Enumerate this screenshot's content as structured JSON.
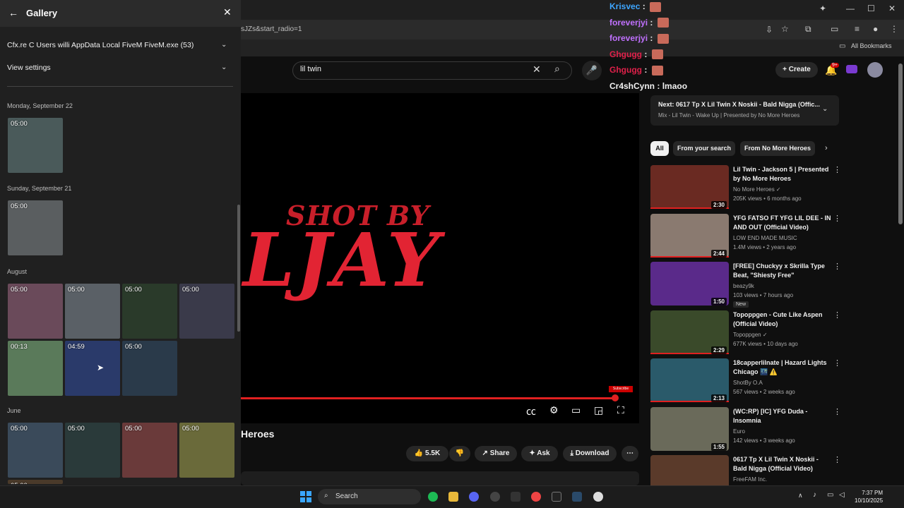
{
  "browser": {
    "url_fragment": "sJZs&start_radio=1",
    "bookmarks_label": "All Bookmarks"
  },
  "youtube": {
    "search_value": "lil twin",
    "create_label": "Create",
    "notification_count": "9+",
    "video_overlay_line1": "SHOT BY",
    "video_overlay_line2": "LJAY",
    "subscribe_watermark": "Subscribe",
    "progress_fraction": 0.94,
    "video_title_partial": "Heroes",
    "actions": {
      "likes": "5.5K",
      "share": "Share",
      "ask": "Ask",
      "download": "Download"
    },
    "next": {
      "title": "Next: 0617 Tp X Lil Twin X Noskii - Bald Nigga (Offic...",
      "subtitle": "Mix - Lil Twin - Wake Up | Presented by No More Heroes"
    },
    "chips": [
      "All",
      "From your search",
      "From No More Heroes"
    ],
    "recommendations": [
      {
        "title": "Lil Twin - Jackson 5 | Presented by No More Heroes",
        "channel": "No More Heroes",
        "verified": true,
        "meta": "205K views • 6 months ago",
        "duration": "2:30",
        "badge": "",
        "thumb_color": "#6a2a22",
        "watched_bar": true
      },
      {
        "title": "YFG FATSO FT YFG LIL DEE - IN AND OUT (Official Video)",
        "channel": "LOW END MADE MUSIC",
        "verified": false,
        "meta": "1.4M views • 2 years ago",
        "duration": "2:44",
        "badge": "",
        "thumb_color": "#8a7a70",
        "watched_bar": true
      },
      {
        "title": "[FREE] Chuckyy x Skrilla Type Beat, \"Shiesty Free\"",
        "channel": "beazy9k",
        "verified": false,
        "meta": "103 views • 7 hours ago",
        "duration": "1:50",
        "badge": "New",
        "thumb_color": "#5a2a8a",
        "watched_bar": false
      },
      {
        "title": "Topoppgen - Cute Like Aspen (Official Video)",
        "channel": "Topoppgen",
        "verified": true,
        "meta": "677K views • 10 days ago",
        "duration": "2:29",
        "badge": "",
        "thumb_color": "#3a4a2a",
        "watched_bar": true
      },
      {
        "title": "18capperlilnate | Hazard Lights Chicago 🌃 ⚠️",
        "channel": "ShotBy O.A",
        "verified": false,
        "meta": "567 views • 2 weeks ago",
        "duration": "2:13",
        "badge": "",
        "thumb_color": "#2a5a6a",
        "watched_bar": true
      },
      {
        "title": "(WC:RP) [IC] YFG Duda - Insomnia",
        "channel": "Euro",
        "verified": false,
        "meta": "142 views • 3 weeks ago",
        "duration": "1:55",
        "badge": "",
        "thumb_color": "#6a6a5a",
        "watched_bar": false
      },
      {
        "title": "0617 Tp X Lil Twin X Noskii - Bald Nigga (Official Video)",
        "channel": "FreeFAM Inc.",
        "verified": false,
        "meta": "",
        "duration": "",
        "badge": "",
        "thumb_color": "#5a3a2a",
        "watched_bar": false
      }
    ],
    "chat": [
      {
        "user": "Krisvec",
        "message": "",
        "color": "#3ea6ff",
        "emote": true
      },
      {
        "user": "foreverjyi",
        "message": "",
        "color": "#c070ff",
        "emote": true
      },
      {
        "user": "foreverjyi",
        "message": "",
        "color": "#c070ff",
        "emote": true
      },
      {
        "user": "Ghgugg",
        "message": "",
        "color": "#e0204a",
        "emote": true
      },
      {
        "user": "Ghgugg",
        "message": "",
        "color": "#e0204a",
        "emote": true
      },
      {
        "user": "Cr4shCynn",
        "message": "lmaoo",
        "color": "#f1f1f1",
        "emote": false
      }
    ]
  },
  "gallery": {
    "title": "Gallery",
    "source_label": "Cfx.re C Users willi AppData Local FiveM FiveM.exe (53)",
    "view_settings_label": "View settings",
    "sections": [
      {
        "date": "Monday, September 22",
        "items": [
          {
            "duration": "05:00",
            "color": "#4a5a5a"
          }
        ]
      },
      {
        "date": "Sunday, September 21",
        "items": [
          {
            "duration": "05:00",
            "color": "#5a5e60"
          }
        ]
      },
      {
        "date": "August",
        "items": [
          {
            "duration": "05:00",
            "color": "#6a4a5a"
          },
          {
            "duration": "05:00",
            "color": "#5a6066"
          },
          {
            "duration": "05:00",
            "color": "#2a3a2a"
          },
          {
            "duration": "05:00",
            "color": "#3a3a4a"
          },
          {
            "duration": "00:13",
            "color": "#5a7a5a"
          },
          {
            "duration": "04:59",
            "color": "#2a3a6a"
          },
          {
            "duration": "05:00",
            "color": "#2a3a4a"
          }
        ]
      },
      {
        "date": "June",
        "items": [
          {
            "duration": "05:00",
            "color": "#3a4a5a"
          },
          {
            "duration": "05:00",
            "color": "#2a3a3a"
          },
          {
            "duration": "05:00",
            "color": "#6a3a3a"
          },
          {
            "duration": "05:00",
            "color": "#6a6a3a"
          },
          {
            "duration": "05:00",
            "color": "#4a3a2a"
          }
        ]
      }
    ]
  },
  "taskbar": {
    "search_label": "Search",
    "time": "7:37 PM",
    "date": "10/10/2025"
  }
}
